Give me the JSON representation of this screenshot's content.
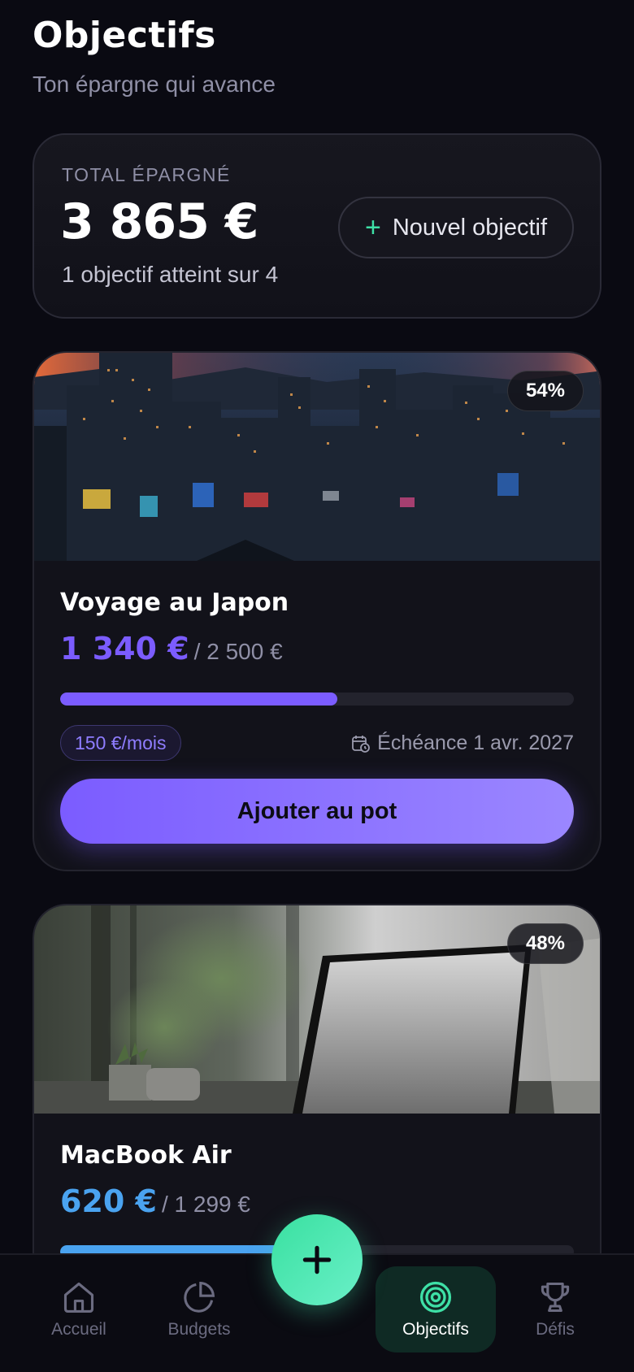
{
  "header": {
    "title": "Objectifs",
    "subtitle": "Ton épargne qui avance"
  },
  "summary": {
    "label": "TOTAL ÉPARGNÉ",
    "amount": "3 865 €",
    "status": "1 objectif atteint sur 4",
    "new_goal_label": "Nouvel objectif"
  },
  "goals": [
    {
      "name": "Voyage au Japon",
      "saved": "1 340 €",
      "target": "/ 2 500 €",
      "percent_label": "54%",
      "progress": 0.54,
      "monthly": "150 €/mois",
      "deadline": "Échéance 1 avr. 2027",
      "button_label": "Ajouter au pot",
      "accent": "#7b5cff",
      "image": "city-night-photo"
    },
    {
      "name": "MacBook Air",
      "saved": "620 €",
      "target": "/ 1 299 €",
      "percent_label": "48%",
      "progress": 0.48,
      "accent": "#4aa3f0",
      "image": "laptop-desk-photo"
    }
  ],
  "nav": {
    "items": [
      {
        "label": "Accueil",
        "icon": "home-icon"
      },
      {
        "label": "Budgets",
        "icon": "pie-chart-icon"
      },
      {
        "label": "Objectifs",
        "icon": "target-icon",
        "active": true
      },
      {
        "label": "Défis",
        "icon": "trophy-icon"
      }
    ],
    "fab_icon": "plus-icon"
  }
}
